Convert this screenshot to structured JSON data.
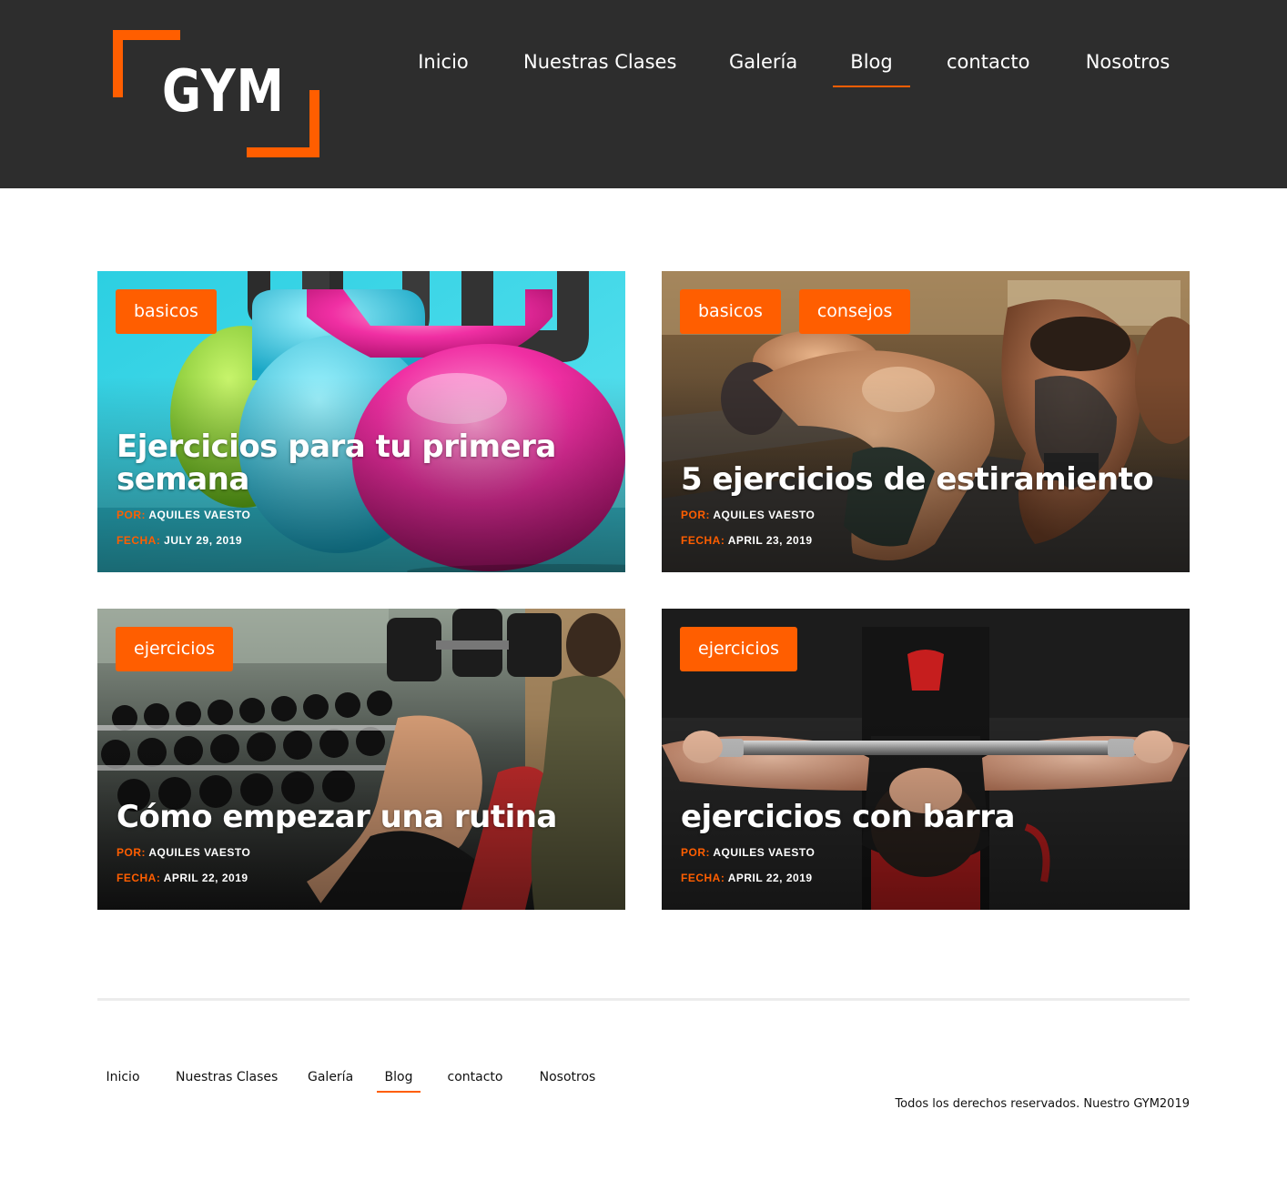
{
  "brand": {
    "logo_text": "GYM",
    "accent": "#ff5e00",
    "header_bg": "#2d2d2d"
  },
  "nav": {
    "items": [
      {
        "label": "Inicio"
      },
      {
        "label": "Nuestras Clases"
      },
      {
        "label": "Galería"
      },
      {
        "label": "Blog",
        "active": true
      },
      {
        "label": "contacto"
      },
      {
        "label": "Nosotros"
      }
    ]
  },
  "posts": [
    {
      "tags": [
        "basicos"
      ],
      "title": "Ejercicios para tu primera semana",
      "author_label": "POR:",
      "author": "AQUILES VAESTO",
      "date_label": "FECHA:",
      "date": "JULY 29, 2019"
    },
    {
      "tags": [
        "basicos",
        "consejos"
      ],
      "title": "5 ejercicios de estiramiento",
      "author_label": "POR:",
      "author": "AQUILES VAESTO",
      "date_label": "FECHA:",
      "date": "APRIL 23, 2019"
    },
    {
      "tags": [
        "ejercicios"
      ],
      "title": "Cómo empezar una rutina",
      "author_label": "POR:",
      "author": "AQUILES VAESTO",
      "date_label": "FECHA:",
      "date": "APRIL 22, 2019"
    },
    {
      "tags": [
        "ejercicios"
      ],
      "title": "ejercicios con barra",
      "author_label": "POR:",
      "author": "AQUILES VAESTO",
      "date_label": "FECHA:",
      "date": "APRIL 22, 2019"
    }
  ],
  "footer": {
    "nav": [
      {
        "label": "Inicio"
      },
      {
        "label": "Nuestras Clases"
      },
      {
        "label": "Galería"
      },
      {
        "label": "Blog",
        "active": true
      },
      {
        "label": "contacto"
      },
      {
        "label": "Nosotros"
      }
    ],
    "copyright": "Todos los derechos reservados. Nuestro GYM2019"
  }
}
